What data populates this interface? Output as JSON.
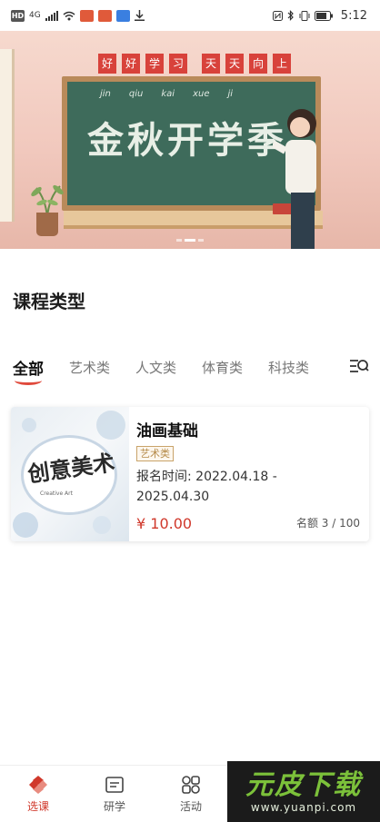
{
  "status_bar": {
    "left_badges": [
      "HD",
      "4G"
    ],
    "time": "5:12"
  },
  "banner": {
    "sign_left": [
      "好",
      "好",
      "学",
      "习"
    ],
    "sign_right": [
      "天",
      "天",
      "向",
      "上"
    ],
    "pinyin": [
      "jin",
      "qiu",
      "kai",
      "xue",
      "ji"
    ],
    "title": "金秋开学季"
  },
  "section": {
    "title": "课程类型"
  },
  "tabs": [
    {
      "label": "全部",
      "active": true
    },
    {
      "label": "艺术类",
      "active": false
    },
    {
      "label": "人文类",
      "active": false
    },
    {
      "label": "体育类",
      "active": false
    },
    {
      "label": "科技类",
      "active": false
    }
  ],
  "filter_icon": "search-filter-icon",
  "course": {
    "thumb_title": "创意美术",
    "thumb_sub": "Creative Art",
    "name": "油画基础",
    "tag": "艺术类",
    "time_label": "报名时间:",
    "time_value": "2022.04.18 - 2025.04.30",
    "price": "¥ 10.00",
    "quota": "名额 3 / 100"
  },
  "bottom_nav": [
    {
      "label": "选课",
      "icon": "course-select-icon",
      "active": true
    },
    {
      "label": "研学",
      "icon": "study-icon",
      "active": false
    },
    {
      "label": "活动",
      "icon": "activity-icon",
      "active": false
    }
  ],
  "watermark": {
    "logo": "元皮下载",
    "url": "www.yuanpi.com"
  },
  "colors": {
    "accent": "#d0382b",
    "tag_border": "#c9a36a",
    "board": "#3e6b5b"
  }
}
